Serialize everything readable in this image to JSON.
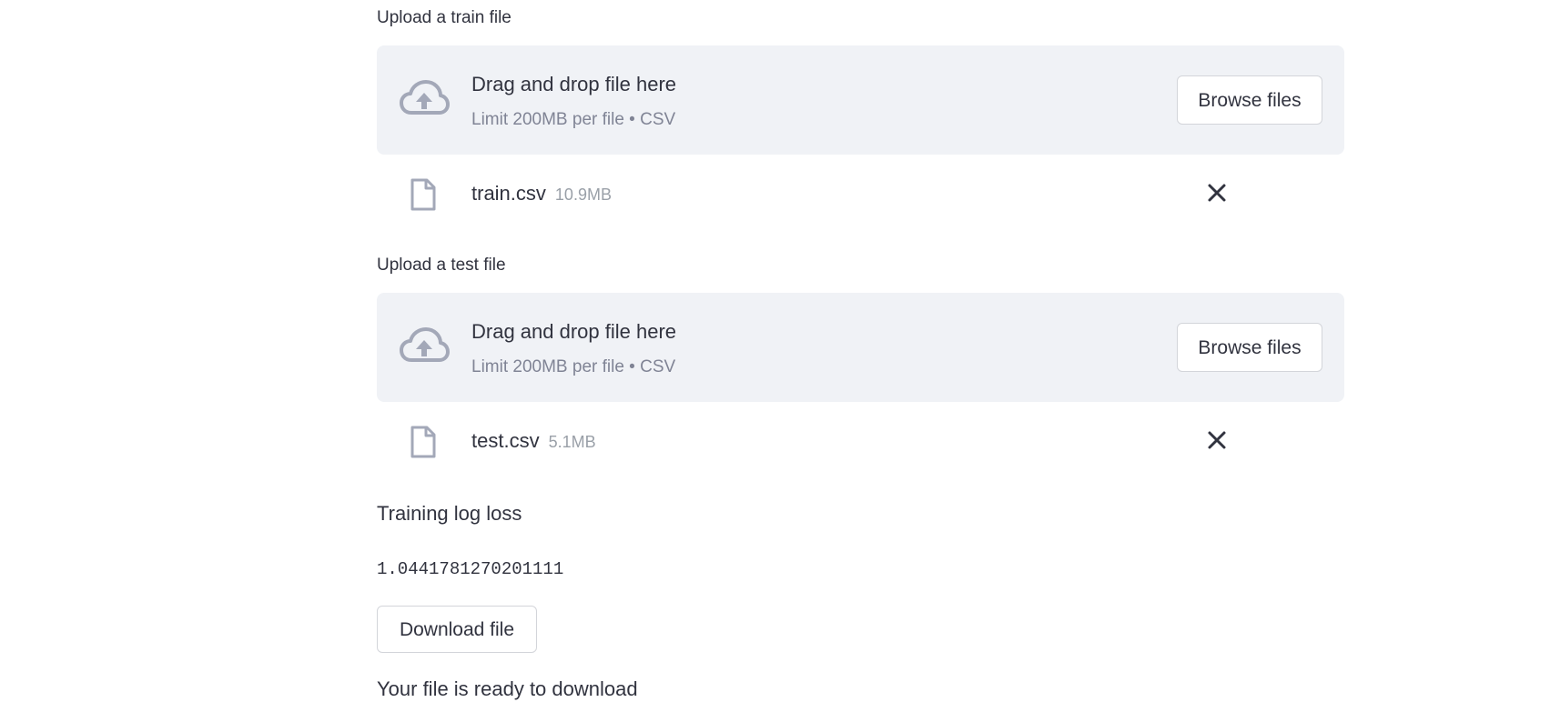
{
  "train_uploader": {
    "label": "Upload a train file",
    "dropzone_title": "Drag and drop file here",
    "dropzone_limit": "Limit 200MB per file • CSV",
    "browse_label": "Browse files",
    "file": {
      "name": "train.csv",
      "size": "10.9MB"
    }
  },
  "test_uploader": {
    "label": "Upload a test file",
    "dropzone_title": "Drag and drop file here",
    "dropzone_limit": "Limit 200MB per file • CSV",
    "browse_label": "Browse files",
    "file": {
      "name": "test.csv",
      "size": "5.1MB"
    }
  },
  "metric": {
    "heading": "Training log loss",
    "value": "1.0441781270201111"
  },
  "download": {
    "button_label": "Download file",
    "status_text": "Your file is ready to download"
  },
  "icons": {
    "upload": "cloud-upload-icon",
    "file": "file-icon",
    "remove": "close-icon"
  },
  "colors": {
    "dropzone_bg": "#f0f2f6",
    "icon": "#a3a8b8",
    "text": "#31333f",
    "muted_text": "#808495"
  }
}
